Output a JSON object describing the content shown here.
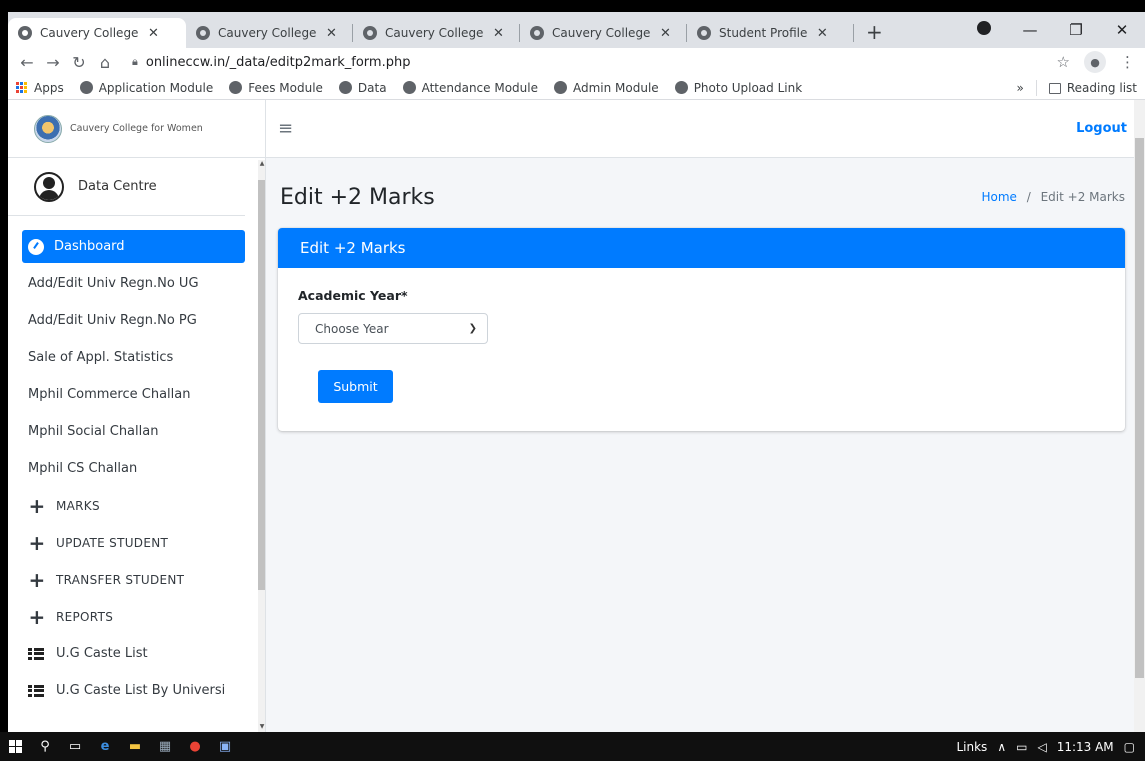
{
  "browser": {
    "tabs": [
      {
        "title": "Cauvery College",
        "active": true
      },
      {
        "title": "Cauvery College",
        "active": false
      },
      {
        "title": "Cauvery College",
        "active": false
      },
      {
        "title": "Cauvery College",
        "active": false
      },
      {
        "title": "Student Profile",
        "active": false
      }
    ],
    "new_tab": "+",
    "url": "onlineccw.in/_data/editp2mark_form.php",
    "bookmarks": [
      "Apps",
      "Application Module",
      "Fees Module",
      "Data",
      "Attendance Module",
      "Admin Module",
      "Photo Upload Link"
    ],
    "more_bookmarks": "»",
    "reading_list": "Reading list"
  },
  "sidebar": {
    "brand": "Cauvery College for Women",
    "user": "Data Centre",
    "items": [
      {
        "label": "Dashboard",
        "icon": "dashboard-icon",
        "active": true
      },
      {
        "label": "Add/Edit Univ Regn.No UG"
      },
      {
        "label": "Add/Edit Univ Regn.No PG"
      },
      {
        "label": "Sale of Appl. Statistics"
      },
      {
        "label": "Mphil Commerce Challan"
      },
      {
        "label": "Mphil Social Challan"
      },
      {
        "label": "Mphil CS Challan"
      },
      {
        "label": "MARKS",
        "icon": "plus-icon"
      },
      {
        "label": "UPDATE STUDENT",
        "icon": "plus-icon"
      },
      {
        "label": "TRANSFER STUDENT",
        "icon": "plus-icon"
      },
      {
        "label": "REPORTS",
        "icon": "plus-icon"
      },
      {
        "label": "U.G Caste List",
        "icon": "list-icon"
      },
      {
        "label": "U.G Caste List By Universi",
        "icon": "list-icon"
      }
    ]
  },
  "topnav": {
    "logout": "Logout"
  },
  "main": {
    "title": "Edit +2 Marks",
    "breadcrumb_home": "Home",
    "breadcrumb_sep": "/",
    "breadcrumb_current": "Edit +2 Marks",
    "card_title": "Edit +2 Marks",
    "field_label": "Academic Year*",
    "select_value": "Choose Year",
    "submit": "Submit"
  },
  "taskbar": {
    "links": "Links",
    "time": "11:13 AM"
  }
}
